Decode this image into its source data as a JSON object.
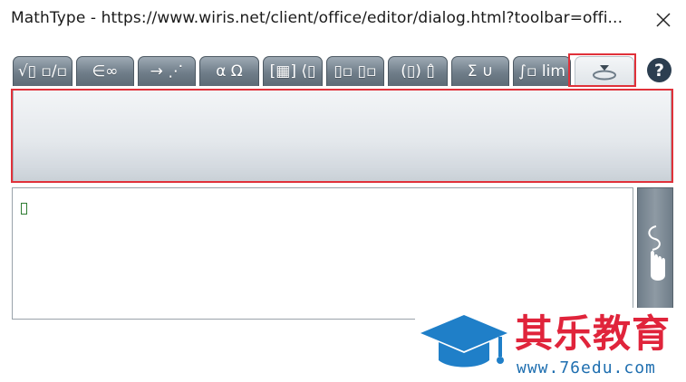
{
  "window": {
    "title": "MathType - https://www.wiris.net/client/office/editor/dialog.html?toolbar=offi...",
    "close_icon": "close-icon"
  },
  "tabs": [
    {
      "id": "general",
      "label": "√▯ ▫/▫",
      "active": false
    },
    {
      "id": "symbols",
      "label": "∈∞",
      "active": false
    },
    {
      "id": "arrows",
      "label": "→ ⋰",
      "active": false
    },
    {
      "id": "greek",
      "label": "α Ω",
      "active": false
    },
    {
      "id": "matrices",
      "label": "[▦] ⟨▯",
      "active": false
    },
    {
      "id": "scripts",
      "label": "▯▫ ▯▫",
      "active": false
    },
    {
      "id": "decorations",
      "label": "(▯) ▯̂",
      "active": false
    },
    {
      "id": "big-operators",
      "label": "Σ ∪",
      "active": false
    },
    {
      "id": "calculus",
      "label": "∫▫ lim",
      "active": false
    },
    {
      "id": "handwriting-toolbar",
      "label": "",
      "icon": "collapse-toolbar-icon",
      "active": true
    }
  ],
  "help": {
    "label": "?"
  },
  "editor": {
    "content": ""
  },
  "handwriting_button": {
    "icon": "hand-drawing-icon"
  },
  "watermark": {
    "brand": "其乐教育",
    "url": "www.76edu.com",
    "icon": "graduation-cap-icon"
  },
  "colors": {
    "tab": "#6f7d89",
    "highlight": "#e0313a",
    "caret": "#2e7d32",
    "brand_red": "#e0243b",
    "brand_blue": "#1f6fb0"
  }
}
